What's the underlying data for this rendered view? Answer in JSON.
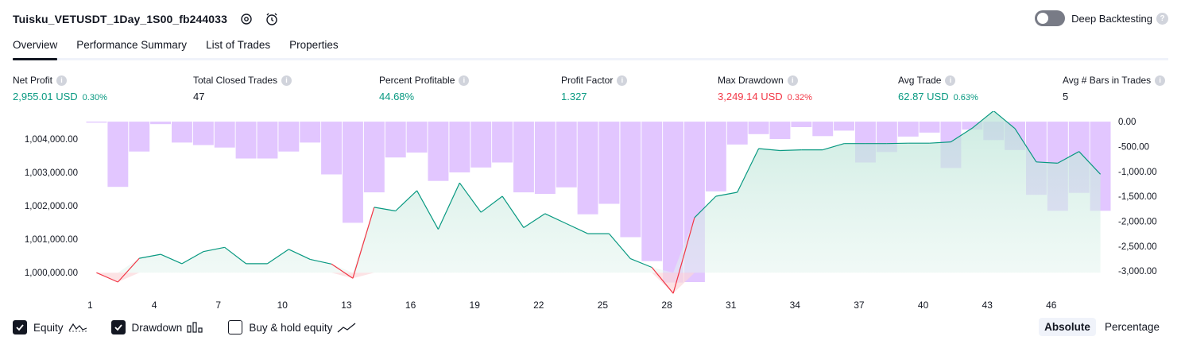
{
  "header": {
    "title": "Tuisku_VETUSDT_1Day_1S00_fb244033",
    "deep_backtesting_label": "Deep Backtesting",
    "deep_backtesting_enabled": false
  },
  "tabs": [
    {
      "label": "Overview",
      "active": true
    },
    {
      "label": "Performance Summary",
      "active": false
    },
    {
      "label": "List of Trades",
      "active": false
    },
    {
      "label": "Properties",
      "active": false
    }
  ],
  "metrics": [
    {
      "label": "Net Profit",
      "value": "2,955.01 USD",
      "pct": "0.30%",
      "tone": "green"
    },
    {
      "label": "Total Closed Trades",
      "value": "47",
      "pct": "",
      "tone": "dark"
    },
    {
      "label": "Percent Profitable",
      "value": "44.68%",
      "pct": "",
      "tone": "green"
    },
    {
      "label": "Profit Factor",
      "value": "1.327",
      "pct": "",
      "tone": "green"
    },
    {
      "label": "Max Drawdown",
      "value": "3,249.14 USD",
      "pct": "0.32%",
      "tone": "red"
    },
    {
      "label": "Avg Trade",
      "value": "62.87 USD",
      "pct": "0.63%",
      "tone": "green"
    },
    {
      "label": "Avg # Bars in Trades",
      "value": "5",
      "pct": "",
      "tone": "dark"
    }
  ],
  "legend": {
    "equity": {
      "label": "Equity",
      "checked": true
    },
    "drawdown": {
      "label": "Drawdown",
      "checked": true
    },
    "buy_hold": {
      "label": "Buy & hold equity",
      "checked": false
    }
  },
  "mode": {
    "absolute_label": "Absolute",
    "percentage_label": "Percentage",
    "selected": "Absolute"
  },
  "colors": {
    "equity_up": "#089981",
    "equity_down": "#f23645",
    "equity_fill": "#d9f0e9",
    "drawdown_bar": "#e2c6ff",
    "text": "#131722",
    "muted": "#d1d4dc"
  },
  "chart_data": {
    "type": "area",
    "x_ticks": [
      "1",
      "4",
      "7",
      "10",
      "13",
      "16",
      "19",
      "22",
      "25",
      "28",
      "31",
      "34",
      "37",
      "40",
      "43",
      "46"
    ],
    "left_axis_ticks": [
      "1,000,000.00",
      "1,001,000.00",
      "1,002,000.00",
      "1,003,000.00",
      "1,004,000.00"
    ],
    "right_axis_ticks": [
      "0.00",
      "-500.00",
      "-1,000.00",
      "-1,500.00",
      "-2,000.00",
      "-2,500.00",
      "-3,000.00"
    ],
    "left_ylim": [
      999600,
      1004600
    ],
    "right_ylim": [
      -3300,
      50
    ],
    "series": [
      {
        "name": "Equity",
        "x": [
          1,
          2,
          3,
          4,
          5,
          6,
          7,
          8,
          9,
          10,
          11,
          12,
          13,
          14,
          15,
          16,
          17,
          18,
          19,
          20,
          21,
          22,
          23,
          24,
          25,
          26,
          27,
          28,
          29,
          30,
          31,
          32,
          33,
          34,
          35,
          36,
          37,
          38,
          39,
          40,
          41,
          42,
          43,
          44,
          45,
          46,
          47,
          48
        ],
        "values": [
          1000000,
          999720,
          1000430,
          1000550,
          1000270,
          1000630,
          1000760,
          1000270,
          1000270,
          1000700,
          1000400,
          1000260,
          999830,
          1001960,
          1001850,
          1002460,
          1001300,
          1002690,
          1001810,
          1002290,
          1001350,
          1001770,
          1001470,
          1001170,
          1001170,
          1000420,
          1000160,
          999380,
          1001650,
          1002290,
          1002410,
          1003720,
          1003660,
          1003680,
          1003680,
          1003870,
          1003870,
          1003870,
          1003880,
          1003880,
          1003920,
          1004330,
          1004850,
          1004320,
          1003320,
          1003280,
          1003630,
          1002950
        ]
      },
      {
        "name": "Drawdown",
        "x": [
          1,
          2,
          3,
          4,
          5,
          6,
          7,
          8,
          9,
          10,
          11,
          12,
          13,
          14,
          15,
          16,
          17,
          18,
          19,
          20,
          21,
          22,
          23,
          24,
          25,
          26,
          27,
          28,
          29,
          30,
          31,
          32,
          33,
          34,
          35,
          36,
          37,
          38,
          39,
          40,
          41,
          42,
          43,
          44,
          45,
          46,
          47,
          48
        ],
        "values": [
          -20,
          -1310,
          -600,
          -50,
          -420,
          -470,
          -520,
          -740,
          -740,
          -600,
          -420,
          -1060,
          -2030,
          -1420,
          -720,
          -620,
          -1190,
          -1020,
          -920,
          -820,
          -1420,
          -1450,
          -1320,
          -1860,
          -1650,
          -2320,
          -2800,
          -3230,
          -3220,
          -1400,
          -460,
          -250,
          -350,
          -110,
          -290,
          -180,
          -820,
          -610,
          -300,
          -220,
          -930,
          -160,
          -370,
          -570,
          -1470,
          -1790,
          -1430,
          -1790
        ]
      }
    ],
    "grid": false,
    "legend_position": "bottom-left"
  }
}
